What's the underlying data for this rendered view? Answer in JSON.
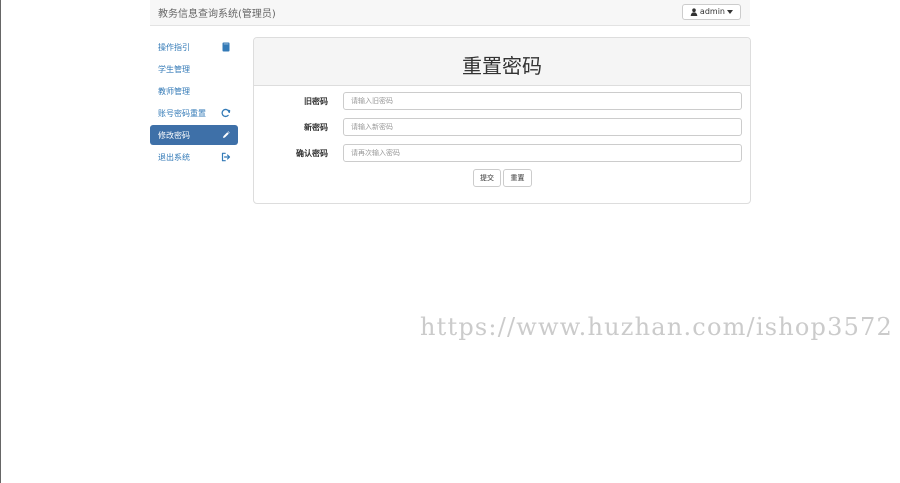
{
  "header": {
    "brand": "教务信息查询系统(管理员)",
    "user_label": "admin"
  },
  "sidebar": {
    "items": [
      {
        "label": "操作指引",
        "icon": "book-icon",
        "active": false
      },
      {
        "label": "学生管理",
        "icon": "",
        "active": false
      },
      {
        "label": "教师管理",
        "icon": "",
        "active": false
      },
      {
        "label": "账号密码重置",
        "icon": "refresh-icon",
        "active": false
      },
      {
        "label": "修改密码",
        "icon": "pencil-icon",
        "active": true
      },
      {
        "label": "退出系统",
        "icon": "logout-icon",
        "active": false
      }
    ]
  },
  "main": {
    "title": "重置密码",
    "fields": [
      {
        "label": "旧密码",
        "placeholder": "请输入旧密码"
      },
      {
        "label": "新密码",
        "placeholder": "请输入新密码"
      },
      {
        "label": "确认密码",
        "placeholder": "请再次输入密码"
      }
    ],
    "buttons": {
      "submit_label": "提交",
      "reset_label": "重置"
    }
  },
  "watermark": {
    "text": "https://www.huzhan.com/ishop3572"
  },
  "colors": {
    "accent": "#3e70a8",
    "link": "#337ab7",
    "panel_heading": "#f5f5f5",
    "navbar": "#f7f7f7"
  }
}
